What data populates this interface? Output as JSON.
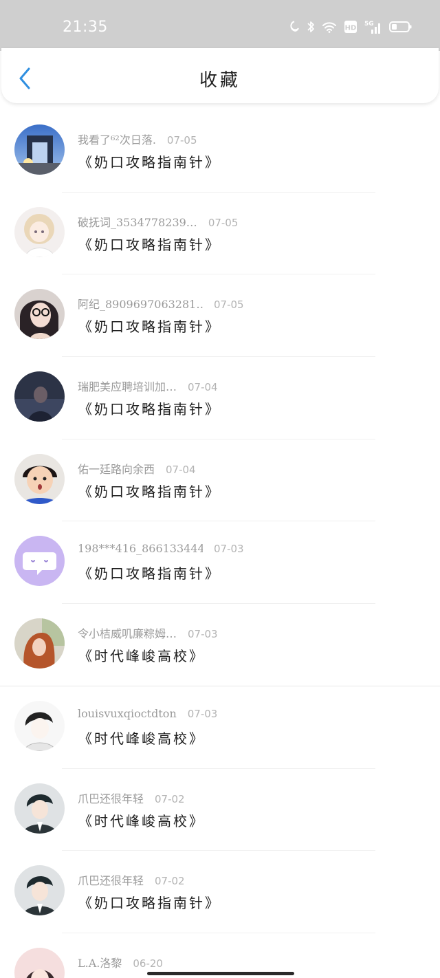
{
  "status_bar": {
    "time": "21:35",
    "icons": [
      "moon-icon",
      "bluetooth-icon",
      "wifi-icon",
      "hd-icon",
      "5g-signal-icon",
      "battery-icon"
    ],
    "hd_label": "HD",
    "network_label": "5G"
  },
  "header": {
    "title": "收藏",
    "back_icon": "chevron-left-icon",
    "accent_color": "#2f8fe0"
  },
  "favorites": [
    {
      "author": "我看了⁶²次日落.",
      "date": "07-05",
      "title": "《奶口攻略指南针》",
      "avatar": "city-arch-photo"
    },
    {
      "author": "破抚词_3534778239…",
      "date": "07-05",
      "title": "《奶口攻略指南针》",
      "avatar": "anime-blonde-girl"
    },
    {
      "author": "阿纪_8909697063281…",
      "date": "07-05",
      "title": "《奶口攻略指南针》",
      "avatar": "girl-with-glasses"
    },
    {
      "author": "瑞肥美应聘培训加…",
      "date": "07-04",
      "title": "《奶口攻略指南针》",
      "avatar": "dark-photo"
    },
    {
      "author": "佑一廷路向余西",
      "date": "07-04",
      "title": "《奶口攻略指南针》",
      "avatar": "surprised-kid"
    },
    {
      "author": "198***416_8661334443",
      "date": "07-03",
      "title": "《奶口攻略指南针》",
      "avatar": "chat-bubble-default"
    },
    {
      "author": "令小桔威叽廉粽姆…",
      "date": "07-03",
      "title": "《时代峰峻高校》",
      "avatar": "red-hair-girl"
    },
    {
      "author": "louisvuxqioctdton",
      "date": "07-03",
      "title": "《时代峰峻高校》",
      "avatar": "anime-boy-sketch"
    },
    {
      "author": "爪巴还很年轻",
      "date": "07-02",
      "title": "《时代峰峻高校》",
      "avatar": "anime-boy-suit"
    },
    {
      "author": "爪巴还很年轻",
      "date": "07-02",
      "title": "《奶口攻略指南针》",
      "avatar": "anime-boy-suit"
    },
    {
      "author": "L.A.洛黎",
      "date": "06-20",
      "title": "",
      "avatar": "pink-girl"
    }
  ]
}
